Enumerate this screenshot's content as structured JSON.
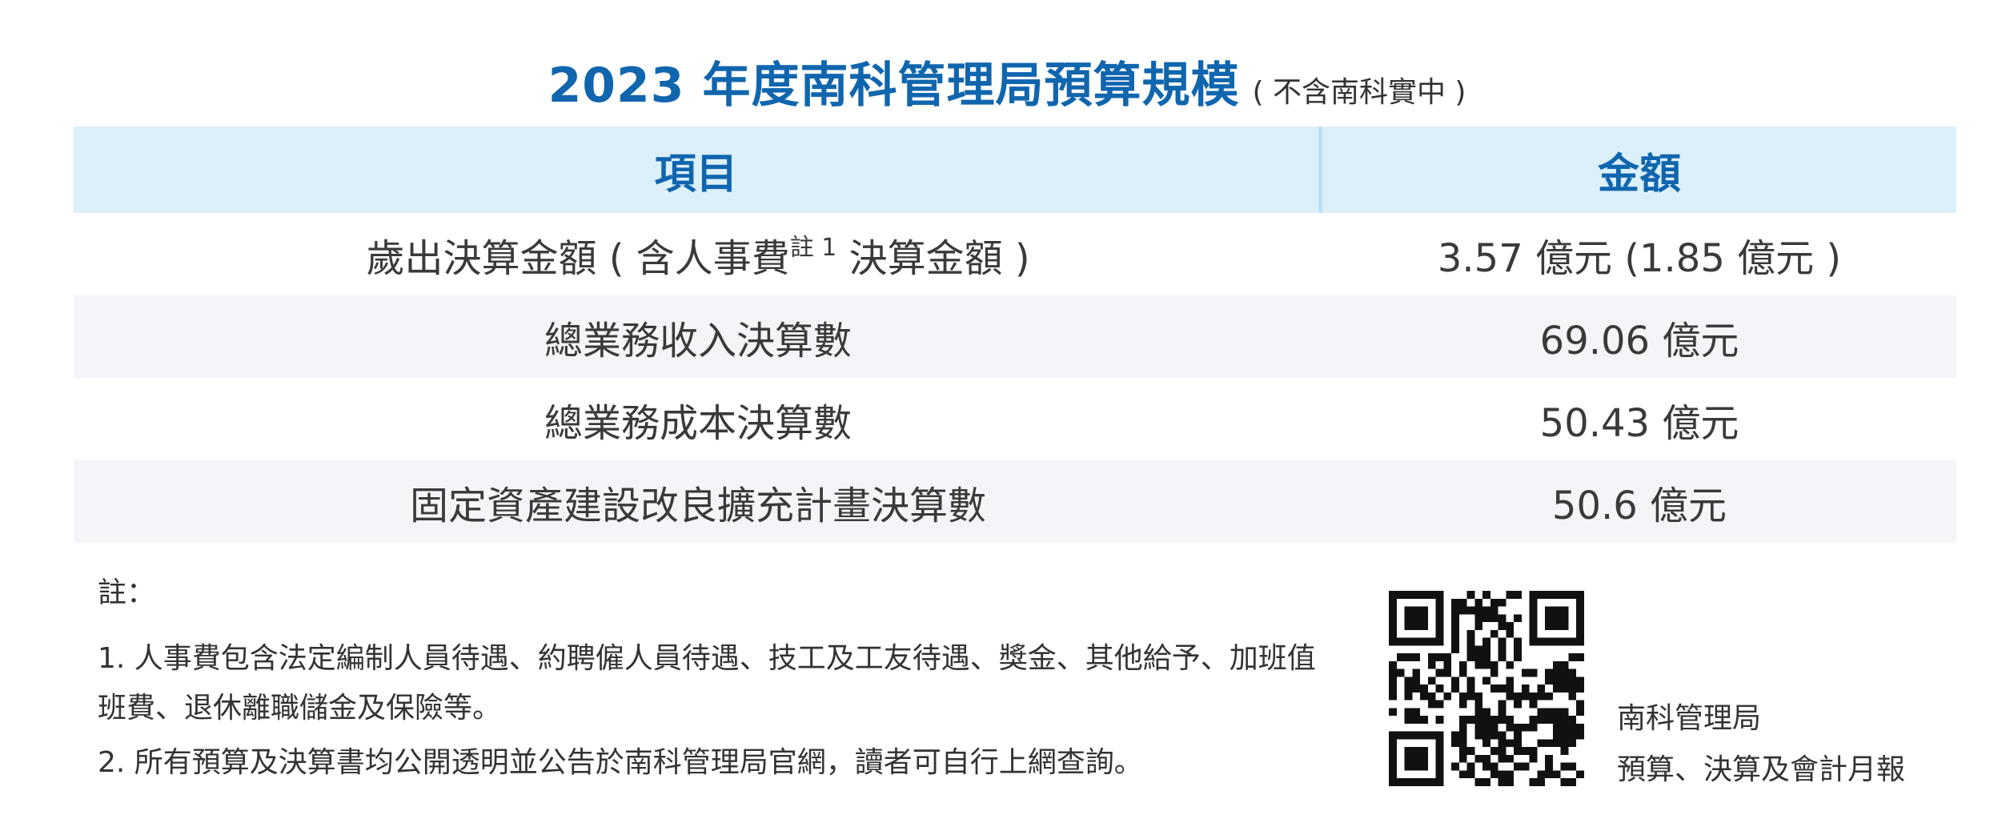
{
  "title": {
    "main": "2023 年度南科管理局預算規模",
    "sub": "( 不含南科實中 )"
  },
  "table": {
    "headers": [
      "項目",
      "金額"
    ],
    "rows": [
      {
        "item_pre": "歲出決算金額 ( 含人事費",
        "item_note": "註 1",
        "item_post": " 決算金額 )",
        "amount": "3.57 億元 (1.85 億元 )"
      },
      {
        "item": "總業務收入決算數",
        "amount": "69.06 億元"
      },
      {
        "item": "總業務成本決算數",
        "amount": "50.43 億元"
      },
      {
        "item": "固定資產建設改良擴充計畫決算數",
        "amount": "50.6 億元"
      }
    ]
  },
  "notes": {
    "heading": "註：",
    "items": [
      "1. 人事費包含法定編制人員待遇、約聘僱人員待遇、技工及工友待遇、獎金、其他給予、加班值班費、退休離職儲金及保險等。",
      "2. 所有預算及決算書均公開透明並公告於南科管理局官網，讀者可自行上網查詢。"
    ]
  },
  "qr": {
    "caption_line1": "南科管理局",
    "caption_line2": "預算、決算及會計月報"
  },
  "colors": {
    "title_blue": "#1066ae",
    "header_bg": "#dcf0fa",
    "stripe_bg": "#f3f5f8",
    "text": "#3a3a3a"
  }
}
